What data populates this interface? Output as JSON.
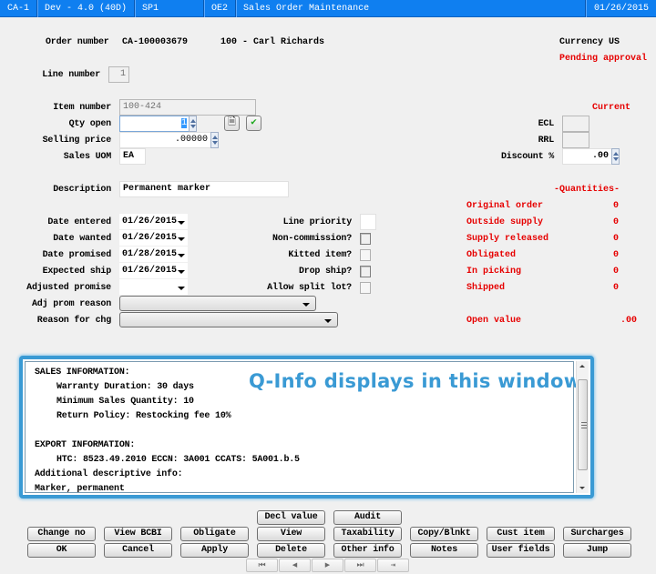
{
  "titlebar": {
    "segments": [
      "CA-1",
      "Dev - 4.0 (40D)",
      "SP1",
      "OE2",
      "Sales Order Maintenance"
    ],
    "date": "01/26/2015",
    "color": "#0f7ff0"
  },
  "header": {
    "order_number_label": "Order number",
    "order_number": "CA-100003679",
    "customer": "100 - Carl Richards",
    "currency_label": "Currency",
    "currency": "US",
    "status": "Pending approval",
    "line_number_label": "Line number",
    "line_number": "1"
  },
  "item": {
    "item_number_label": "Item number",
    "item_number": "100-424",
    "qty_open_label": "Qty open",
    "qty_open": "1",
    "selling_price_label": "Selling price",
    "selling_price": ".00000",
    "sales_uom_label": "Sales UOM",
    "sales_uom": "EA",
    "description_label": "Description",
    "description": "Permanent marker",
    "current_label": "Current",
    "ecl_label": "ECL",
    "ecl": "",
    "rrl_label": "RRL",
    "rrl": "",
    "discount_label": "Discount %",
    "discount": ".00"
  },
  "dates": [
    {
      "label": "Date entered",
      "value": "01/26/2015"
    },
    {
      "label": "Date wanted",
      "value": "01/26/2015"
    },
    {
      "label": "Date promised",
      "value": "01/28/2015"
    },
    {
      "label": "Expected ship",
      "value": "01/26/2015"
    },
    {
      "label": "Adjusted promise",
      "value": ""
    }
  ],
  "reasons": {
    "adj_prom_reason_label": "Adj prom reason",
    "adj_prom_reason": "",
    "reason_for_chg_label": "Reason for chg",
    "reason_for_chg": ""
  },
  "flags": {
    "line_priority_label": "Line priority",
    "line_priority": "",
    "non_commission_label": "Non-commission?",
    "kitted_item_label": "Kitted item?",
    "drop_ship_label": "Drop ship?",
    "allow_split_lot_label": "Allow split lot?"
  },
  "quantities": {
    "title": "-Quantities-",
    "rows": [
      {
        "label": "Original order",
        "value": "0"
      },
      {
        "label": "Outside supply",
        "value": "0"
      },
      {
        "label": "Supply released",
        "value": "0"
      },
      {
        "label": "Obligated",
        "value": "0"
      },
      {
        "label": "In picking",
        "value": "0"
      },
      {
        "label": "Shipped",
        "value": "0"
      }
    ],
    "open_value_label": "Open value",
    "open_value": ".00"
  },
  "qinfo": {
    "overlay_text": "Q-Info displays in this window",
    "lines": [
      "SALES INFORMATION:",
      "    Warranty Duration: 30 days",
      "    Minimum Sales Quantity: 10",
      "    Return Policy: Restocking fee 10%",
      "",
      "EXPORT INFORMATION:",
      "    HTC: 8523.49.2010  ECCN: 3A001  CCATS: 5A001.b.5",
      "Additional descriptive info:",
      "Marker, permanent"
    ],
    "border_color": "#3a9ad4"
  },
  "buttons": {
    "decl_value": "Decl value",
    "audit": "Audit",
    "change_no": "Change no",
    "view_bcbi": "View BCBI",
    "obligate": "Obligate",
    "view": "View",
    "taxability": "Taxability",
    "copy_blnkt": "Copy/Blnkt",
    "cust_item": "Cust item",
    "surcharges": "Surcharges",
    "ok": "OK",
    "cancel": "Cancel",
    "apply": "Apply",
    "delete": "Delete",
    "other_info": "Other info",
    "notes": "Notes",
    "user_fields": "User fields",
    "jump": "Jump"
  },
  "nav": {
    "first": "⏮",
    "prev": "◀",
    "next": "▶",
    "last": "⏭",
    "exit": "⇥"
  }
}
